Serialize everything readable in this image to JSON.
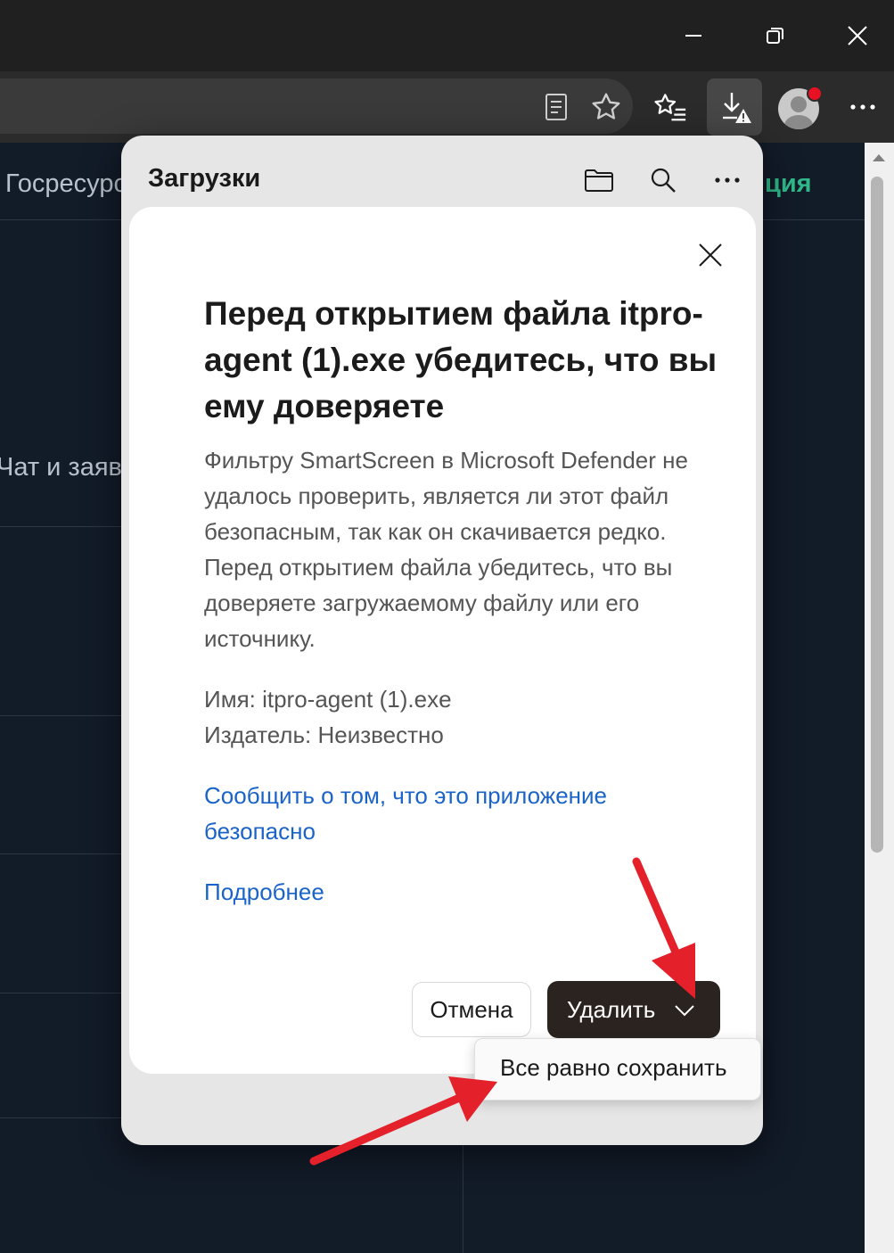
{
  "window": {
    "minimize_icon": "minimize-icon",
    "restore_icon": "restore-icon",
    "close_icon": "close-icon"
  },
  "toolbar": {
    "reader_icon": "reader-mode-icon",
    "favorite_icon": "star-icon",
    "favorites_icon": "favorites-list-icon",
    "downloads_icon": "download-warning-icon",
    "profile_icon": "profile-avatar-icon",
    "more_icon": "more-icon"
  },
  "page": {
    "nav_left": "Госресурс",
    "nav_right": "ция",
    "side_text": "Чат и заяв",
    "accent": "#2fb989"
  },
  "downloads": {
    "title": "Загрузки",
    "folder_icon": "folder-icon",
    "search_icon": "search-icon",
    "more_icon": "more-icon"
  },
  "dialog": {
    "title": "Перед открытием файла itpro-agent (1).exe убедитесь, что вы ему доверяете",
    "body": "Фильтру SmartScreen в Microsoft Defender не удалось проверить, является ли этот файл безопасным, так как он скачивается редко. Перед открытием файла убедитесь, что вы доверяете загружаемому файлу или его источнику.",
    "name_line": "Имя: itpro-agent (1).exe",
    "publisher_line": "Издатель: Неизвестно",
    "report_link": "Сообщить о том, что это приложение безопасно",
    "details_link": "Подробнее",
    "cancel_label": "Отмена",
    "delete_label": "Удалить",
    "link_color": "#1a63c8"
  },
  "menu": {
    "keep_label": "Все равно сохранить"
  },
  "annotations": {
    "arrow_color": "#e4202a"
  }
}
